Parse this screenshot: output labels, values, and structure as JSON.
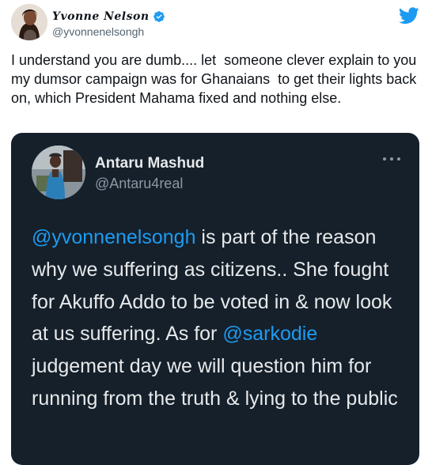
{
  "author": {
    "display_name": "Yvonne Nelson",
    "handle": "@yvonnenelsongh",
    "verified": true,
    "avatar_icon": "profile-photo"
  },
  "brand": {
    "logo_icon": "twitter-bird-icon",
    "color": "#1d9bf0"
  },
  "tweet": {
    "text": "I understand you are dumb.... let  someone clever explain to you my dumsor campaign was for Ghanaians  to get their lights back on, which President Mahama fixed and nothing else."
  },
  "quoted_tweet": {
    "display_name": "Antaru Mashud",
    "handle": "@Antaru4real",
    "more_icon": "more-options-icon",
    "text_parts": {
      "mention_1": "@yvonnenelsongh",
      "text_1": " is part of the reason why we suffering as citizens.. She fought for Akuffo Addo to be voted in & now look at us suffering. As for ",
      "mention_2": "@sarkodie",
      "text_2": " judgement day we will question him for running from the truth & lying to the public"
    },
    "background_color": "#15202b",
    "mention_color": "#1d9bf0"
  }
}
